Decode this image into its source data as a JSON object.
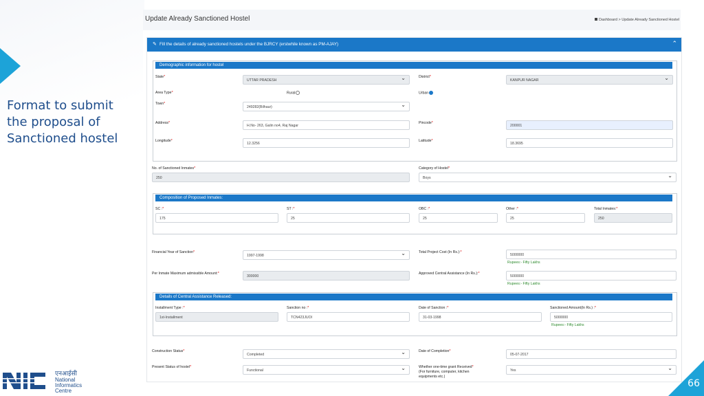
{
  "slide": {
    "caption_lines": [
      "Format to submit",
      "the proposal of",
      "Sanctioned hostel"
    ],
    "page_number": "66",
    "logo": {
      "hindi": "एनआईसी",
      "lines": [
        "National",
        "Informatics",
        "Centre"
      ]
    }
  },
  "app": {
    "page_title": "Update Already Sanctioned Hostel",
    "breadcrumb": {
      "home": "Dashboard",
      "separator": ">",
      "current": "Update Already Sanctioned Hostel"
    }
  },
  "form": {
    "header": "Fill the details of already sanctioned hostels under the BJRCY (erstwhile known as PM-AJAY)",
    "demographic": {
      "title": "Demographic information for hostel",
      "state": {
        "label": "State",
        "value": "UTTAR PRADESH"
      },
      "district": {
        "label": "District",
        "value": "KANPUR NAGAR"
      },
      "area_type": {
        "label": "Area Type",
        "rural": "Rural",
        "urban": "Urban"
      },
      "town": {
        "label": "Town",
        "value": "249282(Bilhaur)"
      },
      "address": {
        "label": "Address",
        "value": "H.No- 263, Galin no4, Raj Nagar"
      },
      "pincode": {
        "label": "Pincode",
        "value": "200001"
      },
      "longitude": {
        "label": "Longitude",
        "value": "12.3256"
      },
      "latitude": {
        "label": "Latitude",
        "value": "18.3695"
      }
    },
    "sanctioned_inmates": {
      "label": "No. of Sanctioned Inmates",
      "value": "250"
    },
    "category": {
      "label": "Category of Hostel",
      "value": "Boys"
    },
    "composition": {
      "title": "Composition of Proposed Inmates:",
      "sc": {
        "label": "SC :",
        "value": "175"
      },
      "st": {
        "label": "ST :",
        "value": "25"
      },
      "obc": {
        "label": "OBC :",
        "value": "25"
      },
      "other": {
        "label": "Other :",
        "value": "25"
      },
      "total": {
        "label": "Total Inmates:",
        "value": "250"
      }
    },
    "financial_year": {
      "label": "Financial Year of Sanction",
      "value": "1997-1998"
    },
    "total_cost": {
      "label": "Total Project Cost (In Rs.):",
      "value": "5000000",
      "words": "Rupees:- Fifty Lakhs"
    },
    "per_inmate": {
      "label": "Per Inmate Maximum admissible Amount:",
      "value": "300000"
    },
    "central_assistance": {
      "label": "Approved Central Assistance (In Rs.):",
      "value": "5000000",
      "words": "Rupees:- Fifty Lakhs"
    },
    "release": {
      "title": "Details of Central Assistance Released:",
      "installment": {
        "label": "Installment Type :",
        "value": "1st-Installment"
      },
      "sanction_no": {
        "label": "Sanction no :",
        "value": "TCN423JUOI"
      },
      "sanction_date": {
        "label": "Date of Sanction :",
        "value": "31-03-1998"
      },
      "sanctioned_amount": {
        "label": "Sanctioned Amount(In Rs.) :",
        "value": "5000000",
        "words": "Rupees:- Fifty Lakhs"
      }
    },
    "construction_status": {
      "label": "Construction Status",
      "value": "Completed"
    },
    "completion_date": {
      "label": "Date of Completion",
      "value": "05-07-2017"
    },
    "present_status": {
      "label": "Present Status of hostel",
      "value": "Functional"
    },
    "grant": {
      "label_line1": "Whether one-time grant Received",
      "label_line2": "(For furniture, computer, kitchen",
      "label_line3": "equipments etc.)",
      "value": "Yes"
    }
  },
  "colors": {
    "accent": "#1b78c8",
    "slide_accent": "#1da3d8",
    "caption": "#1f4e8c",
    "hint": "#2e8b2e"
  }
}
